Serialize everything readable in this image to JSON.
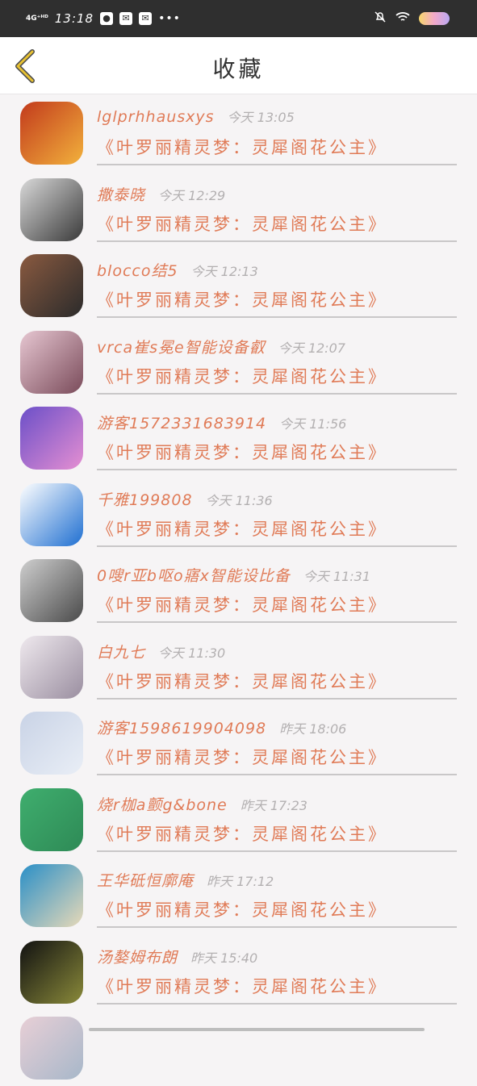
{
  "status_bar": {
    "network": "4G⁺ᴴᴰ",
    "time": "13:18",
    "dots": "•••"
  },
  "header": {
    "title": "收藏"
  },
  "items": [
    {
      "user": "lglprhhausxys",
      "time": "今天 13:05",
      "title": "《叶罗丽精灵梦：灵犀阁花公主》",
      "avatar_colors": [
        "#c23a1c",
        "#f2b13c"
      ]
    },
    {
      "user": "撒泰晓",
      "time": "今天 12:29",
      "title": "《叶罗丽精灵梦：灵犀阁花公主》",
      "avatar_colors": [
        "#d9d9d9",
        "#3a3a3a"
      ]
    },
    {
      "user": "blocco结5",
      "time": "今天 12:13",
      "title": "《叶罗丽精灵梦：灵犀阁花公主》",
      "avatar_colors": [
        "#8a5a40",
        "#2b2b2b"
      ]
    },
    {
      "user": "vrca崔s冕e智能设备叡",
      "time": "今天 12:07",
      "title": "《叶罗丽精灵梦：灵犀阁花公主》",
      "avatar_colors": [
        "#e7c7d2",
        "#7a4b5a"
      ]
    },
    {
      "user": "游客1572331683914",
      "time": "今天 11:56",
      "title": "《叶罗丽精灵梦：灵犀阁花公主》",
      "avatar_colors": [
        "#6b4fc8",
        "#e58fd2"
      ]
    },
    {
      "user": "千雅199808",
      "time": "今天 11:36",
      "title": "《叶罗丽精灵梦：灵犀阁花公主》",
      "avatar_colors": [
        "#ffffff",
        "#1f6fd1"
      ]
    },
    {
      "user": "0嗖r亚b呕o寤x智能设比备",
      "time": "今天 11:31",
      "title": "《叶罗丽精灵梦：灵犀阁花公主》",
      "avatar_colors": [
        "#cfcfcf",
        "#4a4a4a"
      ]
    },
    {
      "user": "白九七",
      "time": "今天 11:30",
      "title": "《叶罗丽精灵梦：灵犀阁花公主》",
      "avatar_colors": [
        "#efe9ee",
        "#9a8ea0"
      ]
    },
    {
      "user": "游客1598619904098",
      "time": "昨天 18:06",
      "title": "《叶罗丽精灵梦：灵犀阁花公主》",
      "avatar_colors": [
        "#c9d3e6",
        "#e9eef6"
      ]
    },
    {
      "user": "烧r枷a颤g&bone",
      "time": "昨天 17:23",
      "title": "《叶罗丽精灵梦：灵犀阁花公主》",
      "avatar_colors": [
        "#3fae6e",
        "#2e8a56"
      ]
    },
    {
      "user": "王华砥恒廓庵",
      "time": "昨天 17:12",
      "title": "《叶罗丽精灵梦：灵犀阁花公主》",
      "avatar_colors": [
        "#2a8fc7",
        "#e7d9b8"
      ]
    },
    {
      "user": "汤嫯姆布朗",
      "time": "昨天 15:40",
      "title": "《叶罗丽精灵梦：灵犀阁花公主》",
      "avatar_colors": [
        "#111111",
        "#8a8a3a"
      ]
    },
    {
      "user": "",
      "time": "",
      "title": "",
      "avatar_colors": [
        "#e8cfd6",
        "#a7b7c9"
      ]
    }
  ]
}
